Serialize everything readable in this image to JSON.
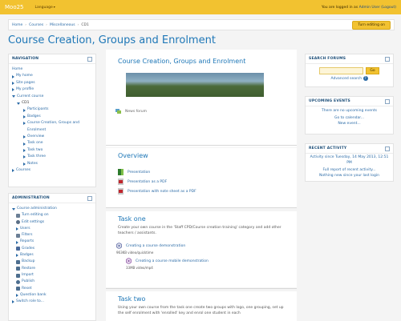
{
  "topbar": {
    "logo": "Moo25",
    "language": "Language",
    "logged_in_text": "You are logged in as",
    "user": "Admin User",
    "logout": "(Logout)"
  },
  "breadcrumb": {
    "items": [
      "Home",
      "Courses",
      "Miscellaneous",
      "CD1"
    ],
    "edit_button": "Turn editing on"
  },
  "page_title": "Course Creation, Groups and Enrolment",
  "navigation": {
    "title": "NAVIGATION",
    "home": "Home",
    "items": [
      "My home",
      "Site pages",
      "My profile",
      "Current course"
    ],
    "course": "CD1",
    "course_items": [
      "Participants",
      "Badges",
      "Course Creation, Groups and",
      "Enrolment",
      "Overview",
      "Task one",
      "Task two",
      "Task three",
      "Notes"
    ],
    "courses": "Courses"
  },
  "administration": {
    "title": "ADMINISTRATION",
    "section": "Course administration",
    "items": [
      "Turn editing on",
      "Edit settings",
      "Users",
      "Filters",
      "Reports",
      "Grades",
      "Badges",
      "Backup",
      "Restore",
      "Import",
      "Publish",
      "Reset",
      "Question bank"
    ],
    "switch_role": "Switch role to..."
  },
  "search_forums": {
    "title": "SEARCH FORUMS",
    "go": "Go",
    "advanced": "Advanced search"
  },
  "upcoming": {
    "title": "UPCOMING EVENTS",
    "none": "There are no upcoming events",
    "calendar": "Go to calendar...",
    "new_event": "New event..."
  },
  "recent": {
    "title": "RECENT ACTIVITY",
    "since": "Activity since Tuesday, 14 May 2013, 12:51 PM",
    "report": "Full report of recent activity...",
    "nothing": "Nothing new since your last login"
  },
  "main": {
    "heading": "Course Creation, Groups and Enrolment",
    "news": "News forum",
    "overview": {
      "title": "Overview",
      "items": [
        "Presentation",
        "Presentation as a PDF",
        "Presentation with note sheet as a PDF"
      ]
    },
    "task_one": {
      "title": "Task one",
      "desc": "Create your own course in the 'Staff CPD/Course creation training' category and add other teachers / assistants.",
      "item1": "Creating a course demonstration",
      "meta1": "963KB video/quicktime",
      "item2": "Creating a course mobile demonstration",
      "meta2": "33MB video/mp4"
    },
    "task_two": {
      "title": "Task two",
      "desc": "Using your own course from the task one create two groups with logo, one grouping, set up the self enrolment with 'enrolled' key and enrol one student in each"
    }
  },
  "colors": {
    "topbar": "#f2c230",
    "link": "#2a6aa6",
    "heading": "#1e77b7"
  }
}
